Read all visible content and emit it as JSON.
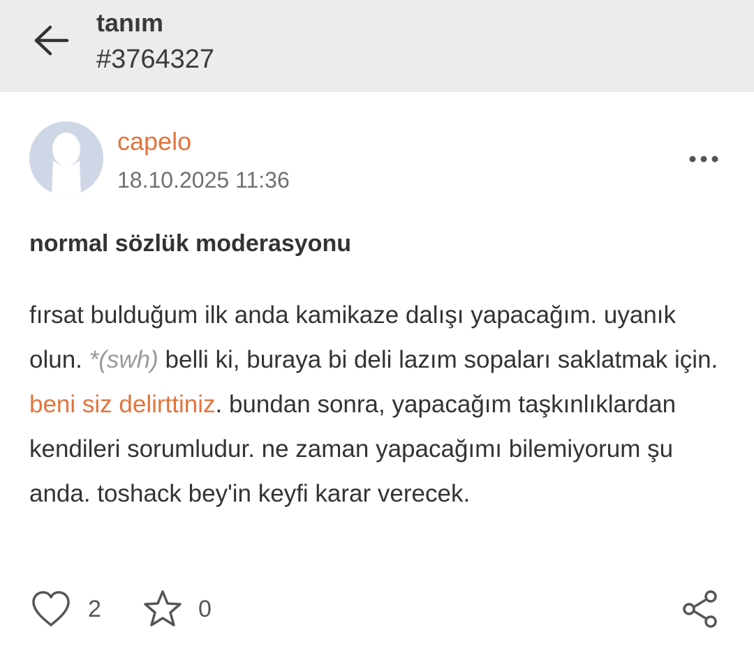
{
  "header": {
    "title": "tanım",
    "subtitle": "#3764327",
    "back_icon": "arrow-left-icon"
  },
  "entry": {
    "author": "capelo",
    "date": "18.10.2025 11:36",
    "topic": "normal sözlük moderasyonu",
    "body": {
      "part1": "fırsat bulduğum ilk anda kamikaze dalışı yapacağım. uyanık olun. ",
      "swh": "*(swh)",
      "part2": " belli ki, buraya bi deli lazım sopaları saklatmak için. ",
      "link": "beni siz delirttiniz",
      "part3": ". bundan sonra, yapacağım taşkınlıklardan kendileri sorumludur. ne zaman yapacağımı bilemiyorum şu anda. toshack bey'in keyfi karar verecek."
    }
  },
  "actions": {
    "like_count": "2",
    "favorite_count": "0",
    "icons": [
      "heart-icon",
      "star-icon",
      "share-icon",
      "more-icon"
    ]
  },
  "colors": {
    "accent": "#e2743c",
    "appbar_bg": "#ececec",
    "text": "#333333",
    "muted": "#707070",
    "avatar_bg": "#cfd6e6"
  }
}
